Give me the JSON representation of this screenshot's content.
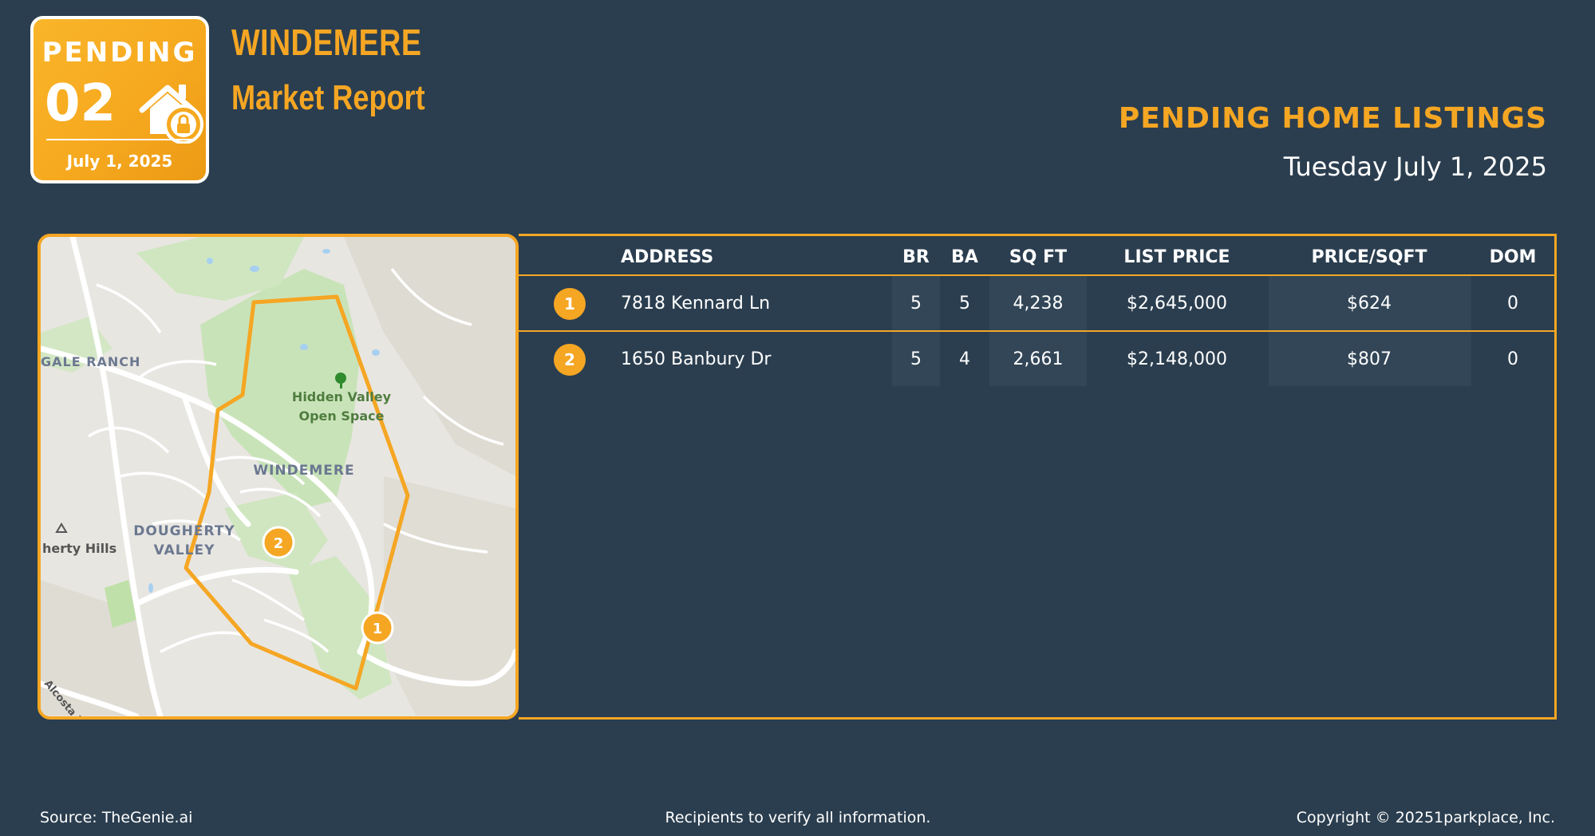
{
  "badge": {
    "title": "PENDING",
    "number": "02",
    "date": "July 1, 2025"
  },
  "header": {
    "area": "WINDEMERE",
    "subtitle": "Market Report"
  },
  "section": {
    "title": "PENDING HOME LISTINGS",
    "date": "Tuesday July 1, 2025"
  },
  "map": {
    "labels": {
      "gale_ranch": "GALE RANCH",
      "hidden_valley_1": "Hidden Valley",
      "hidden_valley_2": "Open Space",
      "windemere": "WINDEMERE",
      "dougherty_1": "DOUGHERTY",
      "dougherty_2": "VALLEY",
      "dougherty_hills": "herty Hills",
      "alcosta": "Alcosta B"
    },
    "markers": [
      "1",
      "2"
    ]
  },
  "table": {
    "headers": [
      "ADDRESS",
      "BR",
      "BA",
      "SQ FT",
      "LIST PRICE",
      "PRICE/SQFT",
      "DOM"
    ],
    "rows": [
      {
        "num": "1",
        "address": "7818 Kennard Ln",
        "br": "5",
        "ba": "5",
        "sqft": "4,238",
        "list_price": "$2,645,000",
        "price_sqft": "$624",
        "dom": "0"
      },
      {
        "num": "2",
        "address": "1650 Banbury Dr",
        "br": "5",
        "ba": "4",
        "sqft": "2,661",
        "list_price": "$2,148,000",
        "price_sqft": "$807",
        "dom": "0"
      }
    ]
  },
  "footer": {
    "source": "Source: TheGenie.ai",
    "disclaimer": "Recipients to verify all information.",
    "copyright": "Copyright © 20251parkplace, Inc."
  },
  "colors": {
    "background": "#2b3e4f",
    "accent": "#f5a623",
    "park": "#cfe6c0"
  }
}
